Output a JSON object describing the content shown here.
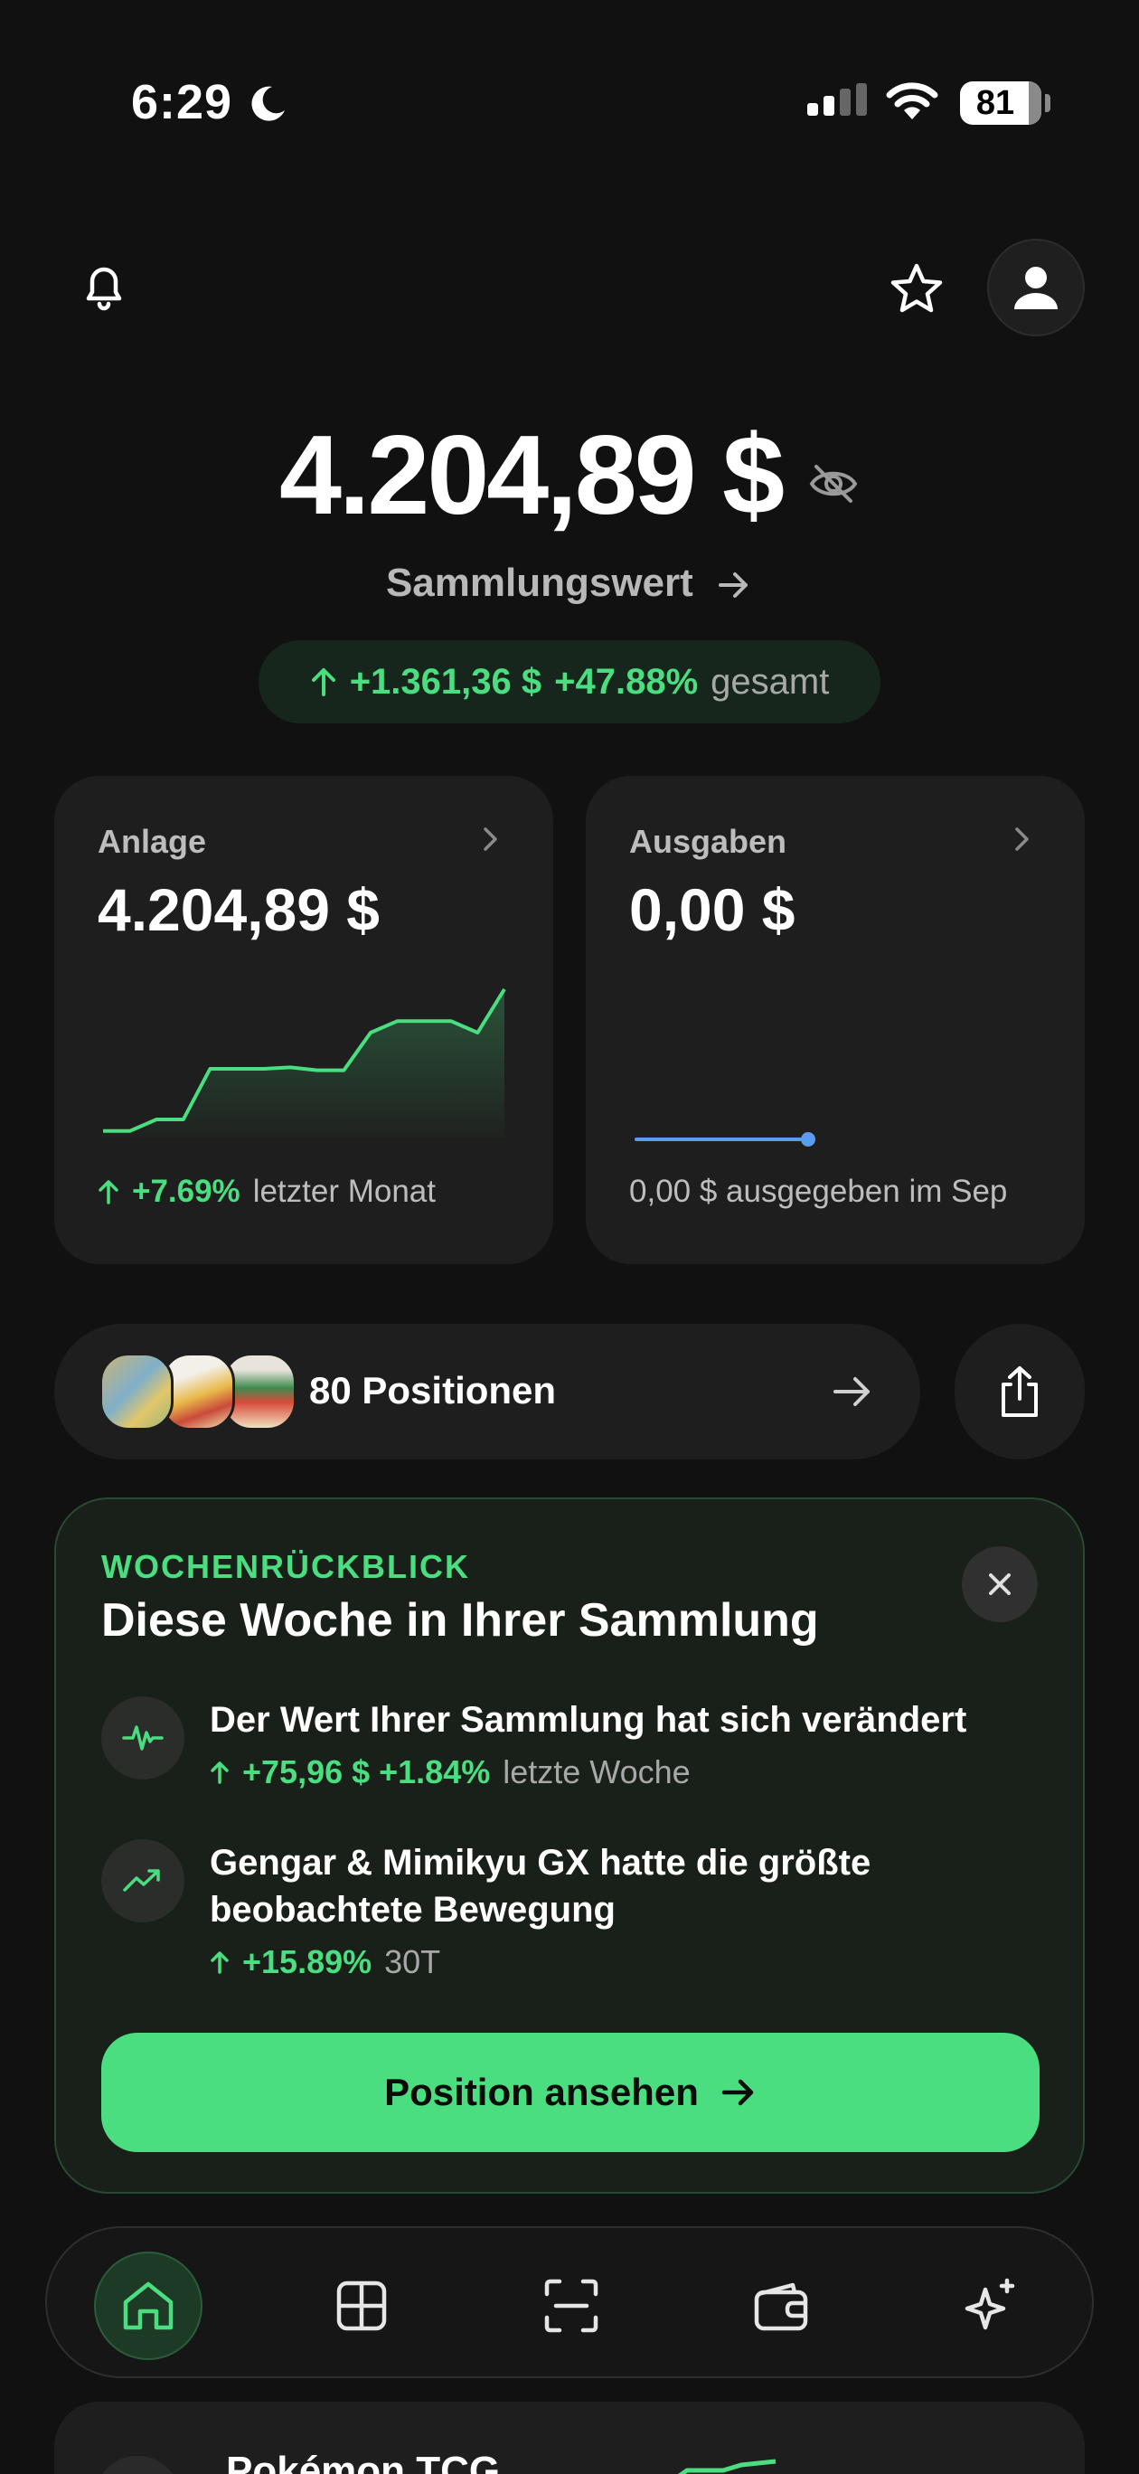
{
  "status": {
    "time": "6:29",
    "battery": "81"
  },
  "header": {
    "value": "4.204,89 $",
    "subtitle": "Sammlungswert"
  },
  "gain_pill": {
    "amount": "+1.361,36 $",
    "percent": "+47.88%",
    "suffix": "gesamt"
  },
  "cards": {
    "anlage": {
      "label": "Anlage",
      "value": "4.204,89 $",
      "change": "+7.69%",
      "period": "letzter Monat"
    },
    "ausgaben": {
      "label": "Ausgaben",
      "value": "0,00 $",
      "note": "0,00 $ ausgegeben im Sep"
    }
  },
  "positions": {
    "label": "80 Positionen"
  },
  "weekly": {
    "eyebrow": "WOCHENRÜCKBLICK",
    "title": "Diese Woche in Ihrer Sammlung",
    "items": [
      {
        "text": "Der Wert Ihrer Sammlung hat sich verändert",
        "change": "+75,96 $ +1.84%",
        "period": "letzte Woche"
      },
      {
        "text": "Gengar & Mimikyu GX hatte die größte beobachtete Bewegung",
        "change": "+15.89%",
        "period": "30T"
      }
    ],
    "button": "Position ansehen"
  },
  "peek": {
    "title": "Pokémon TCG"
  },
  "chart_data": {
    "type": "area",
    "series": [
      {
        "values": [
          0.02,
          0.02,
          0.1,
          0.1,
          0.45,
          0.45,
          0.45,
          0.46,
          0.44,
          0.44,
          0.7,
          0.78,
          0.78,
          0.78,
          0.7,
          1.0
        ]
      }
    ],
    "colors": {
      "line": "#4ade80",
      "spend_line": "#5b9bf0"
    }
  }
}
